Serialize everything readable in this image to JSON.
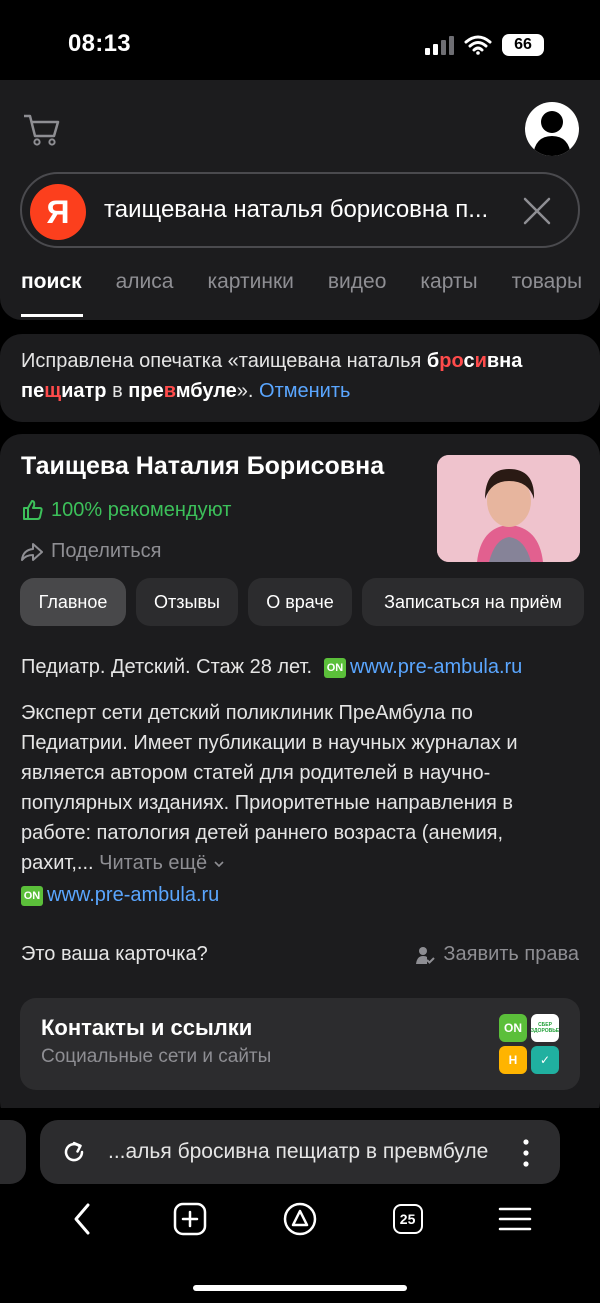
{
  "status": {
    "time": "08:13",
    "battery": "66"
  },
  "search": {
    "logo": "Я",
    "query": "таищевана наталья борисовна п..."
  },
  "tabs": [
    "поиск",
    "алиса",
    "картинки",
    "видео",
    "карты",
    "товары"
  ],
  "typo": {
    "prefix": "Исправлена опечатка «таищевана наталья ",
    "w1a": "б",
    "w1b": "ро",
    "w1c": "с",
    "w1d": "и",
    "w1e": "вна",
    "line2a": "пе",
    "line2b": "щ",
    "line2c": "иатр",
    "mid": " в ",
    "w3a": "пре",
    "w3b": "в",
    "w3c": "мбуле",
    "suffix": "». ",
    "cancel": "Отменить"
  },
  "doctor": {
    "name": "Таищева Наталия Борисовна",
    "recommend": "100% рекомендуют",
    "share": "Поделиться",
    "pills": [
      "Главное",
      "Отзывы",
      "О враче",
      "Записаться на приём"
    ],
    "spec": "Педиатр. Детский. Стаж 28 лет.",
    "site_badge": "ON",
    "site": "www.pre-ambula.ru",
    "description": "Эксперт сети детский поликлиник ПреАмбула по Педиатрии. Имеет публикации в научных журналах и является автором статей для родителей в научно-популярных изданиях. Приоритетные направления в работе: патология детей раннего возраста (анемия, рахит,...",
    "read_more": "Читать ещё",
    "claim_question": "Это ваша карточка?",
    "claim_button": "Заявить права",
    "contacts_title": "Контакты и ссылки",
    "contacts_sub": "Социальные сети и сайты",
    "contact_icons": [
      {
        "label": "ON",
        "color": "#5bbf3a"
      },
      {
        "label": "СБЕР ЗДОРОВЬЕ",
        "color": "#ffffff"
      },
      {
        "label": "Н",
        "color": "#ffb400"
      },
      {
        "label": "✓",
        "color": "#20b0a0"
      }
    ]
  },
  "browser": {
    "url": "...алья бросивна пещиатр в превмбуле",
    "tab_count": "25"
  },
  "colors": {
    "accent_link": "#5aa6ff",
    "recommend_green": "#3cc05a",
    "yandex_red": "#fc3f1d"
  }
}
